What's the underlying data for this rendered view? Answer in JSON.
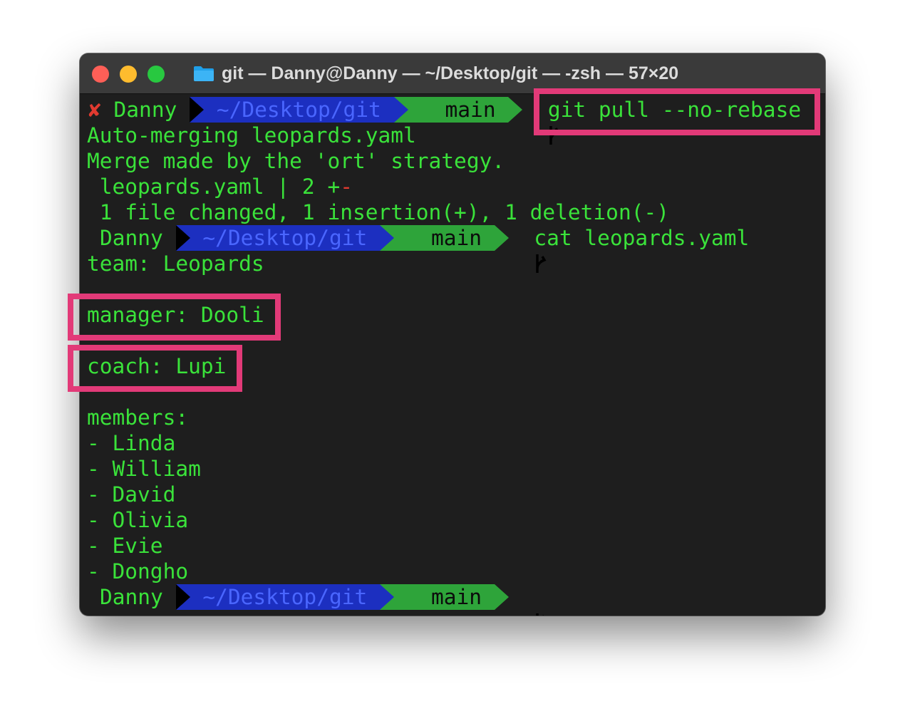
{
  "window": {
    "title": "git — Danny@Danny — ~/Desktop/git — -zsh — 57×20"
  },
  "prompt": {
    "user": "Danny",
    "path": "~/Desktop/git",
    "branch": "main",
    "error_mark": "✘"
  },
  "lines": {
    "cmd1": "git pull --no-rebase",
    "l1": "Auto-merging leopards.yaml",
    "l2": "Merge made by the 'ort' strategy.",
    "l3_file": " leopards.yaml | 2 ",
    "l3_plus": "+",
    "l3_minus": "-",
    "l4": " 1 file changed, 1 insertion(+), 1 deletion(-)",
    "cmd2": "cat leopards.yaml",
    "team": "team: Leopards",
    "manager": "manager: Dooli",
    "coach": "coach: Lupi",
    "members_label": "members:",
    "members": [
      "- Linda",
      "- William",
      "- David",
      "- Olivia",
      "- Evie",
      "- Dongho"
    ]
  },
  "colors": {
    "highlight": "#e23a78",
    "text_green": "#3ae23a",
    "path_blue": "#1c2fc0",
    "branch_green": "#2ea43a"
  }
}
